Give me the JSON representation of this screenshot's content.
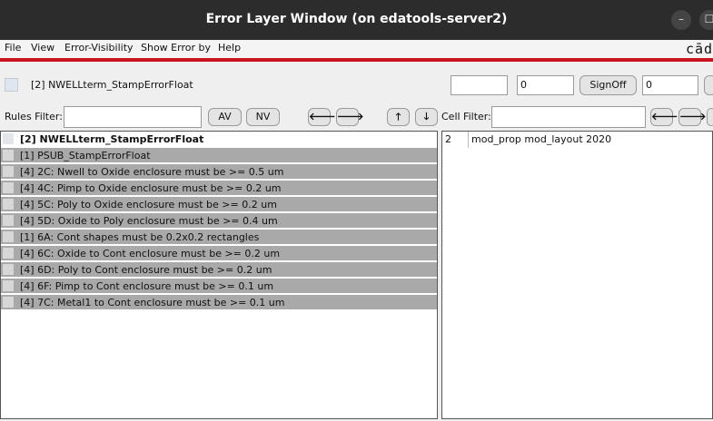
{
  "window": {
    "title": "Error Layer Window (on edatools-server2)",
    "minimize_glyph": "–",
    "maximize_glyph": "☐"
  },
  "menu": {
    "items": [
      "File",
      "View",
      "Error-Visibility",
      "Show Error by",
      "Help"
    ],
    "logo": "cād"
  },
  "toolbar": {
    "current_layer": "[2] NWELLterm_StampErrorFloat",
    "field1": "",
    "field2": "0",
    "signoff_label": "SignOff",
    "field3": "0"
  },
  "filters": {
    "rules_label": "Rules Filter:",
    "rules_value": "",
    "av_label": "AV",
    "nv_label": "NV",
    "left_arrow": "🡐",
    "right_arrow": "🡒",
    "up_arrow": "🡑",
    "down_arrow": "🡓",
    "cell_label": "Cell Filter:",
    "cell_value": ""
  },
  "rules_list": [
    "[2] NWELLterm_StampErrorFloat",
    "[1] PSUB_StampErrorFloat",
    "[4] 2C: Nwell to Oxide enclosure must be >= 0.5 um",
    "[4] 4C: Pimp to Oxide enclosure must be >= 0.2 um",
    "[4] 5C: Poly to Oxide enclosure must be >= 0.2 um",
    "[4] 5D: Oxide to Poly enclosure must be >= 0.4 um",
    "[1] 6A: Cont shapes must be 0.2x0.2 rectangles",
    "[4] 6C: Oxide to Cont enclosure must be >= 0.2 um",
    "[4] 6D: Poly to Cont enclosure must be >= 0.2 um",
    "[4] 6F: Pimp to Cont enclosure must be >= 0.1 um",
    "[4] 7C: Metal1 to Cont enclosure must be >= 0.1 um"
  ],
  "cells": [
    {
      "count": "2",
      "name": "mod_prop mod_layout 2020"
    }
  ],
  "colors": {
    "titlebar": "#2c2c2c",
    "accent_line": "#c8141e",
    "row_gray": "#a9a9a9"
  }
}
